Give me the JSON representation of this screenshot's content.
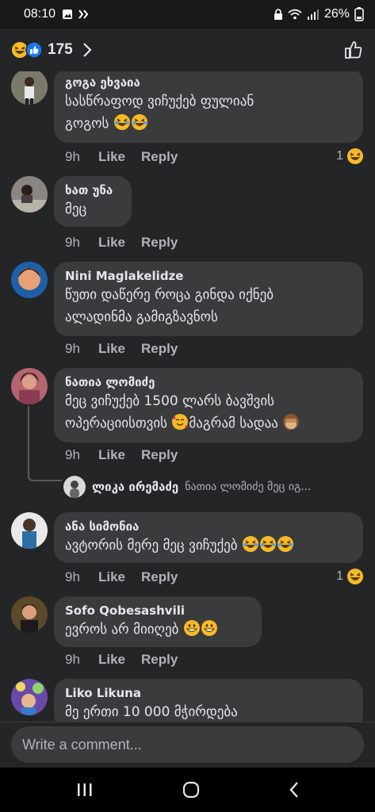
{
  "status": {
    "time": "08:10",
    "battery": "26%"
  },
  "header": {
    "reaction_count": "175"
  },
  "actions": {
    "like": "Like",
    "reply": "Reply"
  },
  "comments": [
    {
      "name": "გოგა ეხვაია",
      "line1": "სასწრაფოდ ვიჩუქებ ფულიან",
      "line2": "გოგოს",
      "time": "9h",
      "reactions": "1"
    },
    {
      "name": "ხათ უნა",
      "line1": "მეც",
      "time": "9h"
    },
    {
      "name": "Nini Maglakelidze",
      "line1": "წუთი დაწერე როცა გინდა იქნებ",
      "line2": "ალადინმა გამიგზავნოს",
      "time": "9h"
    },
    {
      "name": "ნათია ლომიძე",
      "line1": "მეც ვიჩუქებ 1500 ლარს ბავშვის",
      "line2": "ოპერაციისთვის",
      "line2b": "მაგრამ სადაა",
      "time": "9h"
    },
    {
      "name": "ანა სიმონია",
      "line1": "ავტორის მერე მეც ვიჩუქებ",
      "time": "9h",
      "reactions": "1"
    },
    {
      "name": "Sofo Qobesashvili",
      "line1": "ევროს არ მიიღებ",
      "time": "9h"
    },
    {
      "name": "Liko Likuna",
      "line1": "მე ერთი 10 000 მჭირდება"
    }
  ],
  "reply": {
    "name": "ლიკა ირემაძე",
    "text": "ნათია ლომიძე მეც იგ..."
  },
  "composer": {
    "placeholder": "Write a comment..."
  },
  "colors": {
    "bg": "#242526",
    "bubble": "#3a3b3c",
    "muted": "#b0b3b8",
    "like_blue": "#1877f2",
    "emoji_yellow": "#f7b928"
  }
}
